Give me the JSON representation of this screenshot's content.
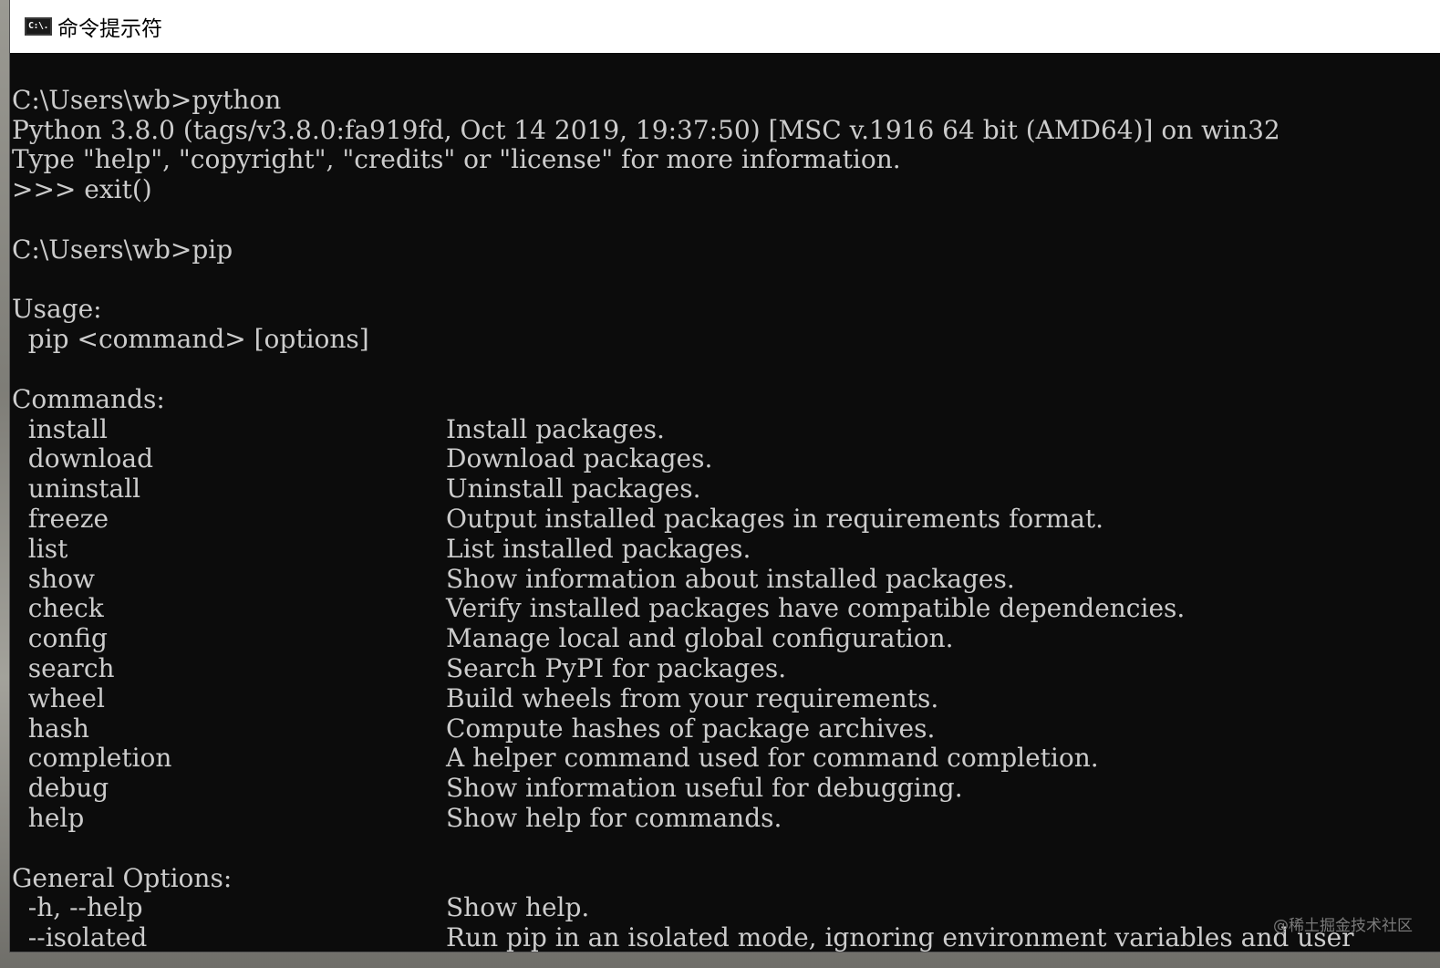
{
  "window": {
    "title": "命令提示符",
    "icon_name": "cmd-icon",
    "icon_text": "C:\\."
  },
  "console": {
    "lines": [
      "",
      "C:\\Users\\wb>python",
      "Python 3.8.0 (tags/v3.8.0:fa919fd, Oct 14 2019, 19:37:50) [MSC v.1916 64 bit (AMD64)] on win32",
      "Type \"help\", \"copyright\", \"credits\" or \"license\" for more information.",
      ">>> exit()",
      "",
      "C:\\Users\\wb>pip",
      "",
      "Usage:",
      "  pip <command> [options]",
      "",
      "Commands:"
    ],
    "commands": [
      {
        "name": "  install",
        "desc": "Install packages."
      },
      {
        "name": "  download",
        "desc": "Download packages."
      },
      {
        "name": "  uninstall",
        "desc": "Uninstall packages."
      },
      {
        "name": "  freeze",
        "desc": "Output installed packages in requirements format."
      },
      {
        "name": "  list",
        "desc": "List installed packages."
      },
      {
        "name": "  show",
        "desc": "Show information about installed packages."
      },
      {
        "name": "  check",
        "desc": "Verify installed packages have compatible dependencies."
      },
      {
        "name": "  config",
        "desc": "Manage local and global configuration."
      },
      {
        "name": "  search",
        "desc": "Search PyPI for packages."
      },
      {
        "name": "  wheel",
        "desc": "Build wheels from your requirements."
      },
      {
        "name": "  hash",
        "desc": "Compute hashes of package archives."
      },
      {
        "name": "  completion",
        "desc": "A helper command used for command completion."
      },
      {
        "name": "  debug",
        "desc": "Show information useful for debugging."
      },
      {
        "name": "  help",
        "desc": "Show help for commands."
      }
    ],
    "general_header": "General Options:",
    "general_options": [
      {
        "name": "  -h, --help",
        "desc": "Show help."
      },
      {
        "name": "  --isolated",
        "desc": "Run pip in an isolated mode, ignoring environment variables and user"
      }
    ]
  },
  "watermark": "@稀土掘金技术社区",
  "colors": {
    "console_bg": "#0c0c0c",
    "console_fg": "#cccccc",
    "titlebar_bg": "#ffffff"
  }
}
